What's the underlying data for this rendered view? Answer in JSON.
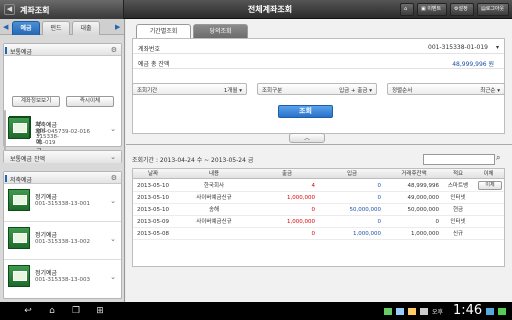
{
  "topbar": {
    "left_title": "계좌조회",
    "center_title": "전체계좌조회",
    "buttons": [
      "이벤트",
      "설정",
      "로그아웃"
    ]
  },
  "sidebar": {
    "tabs": [
      "예금",
      "펀드",
      "대출"
    ],
    "groups": [
      {
        "title": "보통예금",
        "accounts": [
          {
            "name": "보통예금",
            "number": "001-315338-01-019"
          }
        ],
        "buttons": [
          "계좌정보보기",
          "즉시이체"
        ]
      },
      {
        "title": "",
        "accounts": [
          {
            "name": "저축예금",
            "number": "278-045739-02-016"
          }
        ]
      },
      {
        "title": "보통예금 잔액"
      },
      {
        "title": "저축예금",
        "accounts": [
          {
            "name": "정기예금",
            "number": "001-315338-13-001"
          },
          {
            "name": "정기예금",
            "number": "001-315338-13-002"
          },
          {
            "name": "정기예금",
            "number": "001-315338-13-003"
          }
        ]
      }
    ]
  },
  "main": {
    "tabs": [
      "기간별조회",
      "당의조회"
    ],
    "account_label": "계좌번호",
    "account_value": "001-315338-01-019",
    "balance_label": "예금 총 잔액",
    "balance_value": "48,999,996 원",
    "filters": [
      {
        "label": "조회기간",
        "value": "1개월"
      },
      {
        "label": "조회구분",
        "value": "입금 + 출금"
      },
      {
        "label": "정렬순서",
        "value": "최근순"
      }
    ],
    "lookup_label": "조회",
    "period": "조회기간 : 2013-04-24 수 ~ 2013-05-24 금"
  },
  "table": {
    "headers": [
      "날짜",
      "내용",
      "출금",
      "입금",
      "거래후잔액",
      "적요",
      "이체"
    ],
    "rows": [
      {
        "date": "2013-05-10",
        "desc": "한국회사",
        "out": "4",
        "in": "0",
        "bal": "48,999,996",
        "memo": "스마트뱅",
        "btn": "이체"
      },
      {
        "date": "2013-05-10",
        "desc": "사이버예금신규",
        "out": "1,000,000",
        "in": "0",
        "bal": "49,000,000",
        "memo": "인터넷",
        "btn": ""
      },
      {
        "date": "2013-05-10",
        "desc": "송해",
        "out": "0",
        "in": "50,000,000",
        "bal": "50,000,000",
        "memo": "현금",
        "btn": ""
      },
      {
        "date": "2013-05-09",
        "desc": "사이버예금신규",
        "out": "1,000,000",
        "in": "0",
        "bal": "0",
        "memo": "인터넷",
        "btn": ""
      },
      {
        "date": "2013-05-08",
        "desc": "",
        "out": "0",
        "in": "1,000,000",
        "bal": "1,000,000",
        "memo": "신규",
        "btn": ""
      }
    ]
  },
  "status": {
    "ampm": "오후",
    "time": "1:46"
  }
}
